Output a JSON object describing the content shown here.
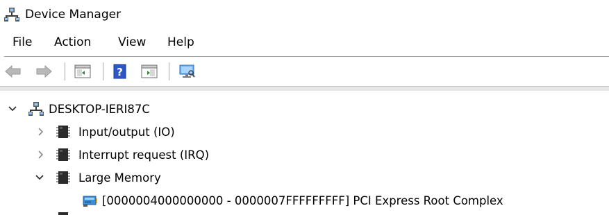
{
  "window": {
    "title": "Device Manager",
    "icon": "device-manager-icon"
  },
  "menu": {
    "items": [
      "File",
      "Action",
      "View",
      "Help"
    ]
  },
  "toolbar": {
    "buttons": [
      {
        "name": "back-button",
        "icon": "back-arrow-icon",
        "enabled": false
      },
      {
        "name": "forward-button",
        "icon": "forward-arrow-icon",
        "enabled": false
      },
      {
        "name": "show-hide-console-tree-button",
        "icon": "console-tree-icon",
        "enabled": true
      },
      {
        "name": "help-button",
        "icon": "help-icon",
        "enabled": true
      },
      {
        "name": "show-action-pane-button",
        "icon": "action-pane-icon",
        "enabled": true
      },
      {
        "name": "scan-hardware-button",
        "icon": "monitor-icon",
        "enabled": true
      }
    ]
  },
  "tree": {
    "root": {
      "label": "DESKTOP-IERI87C",
      "expanded": true,
      "icon": "computer-icon"
    },
    "children": [
      {
        "label": "Input/output (IO)",
        "expanded": false,
        "icon": "chip-icon"
      },
      {
        "label": "Interrupt request (IRQ)",
        "expanded": false,
        "icon": "chip-icon"
      },
      {
        "label": "Large Memory",
        "expanded": true,
        "icon": "chip-icon"
      }
    ],
    "grandchildren": [
      {
        "label": "[0000004000000000 - 0000007FFFFFFFFF]  PCI Express Root Complex",
        "icon": "pci-device-icon"
      }
    ]
  },
  "colors": {
    "accent_blue": "#1e6fd0",
    "separator": "#a0a0a0",
    "chip_dark": "#2b2b2b"
  }
}
